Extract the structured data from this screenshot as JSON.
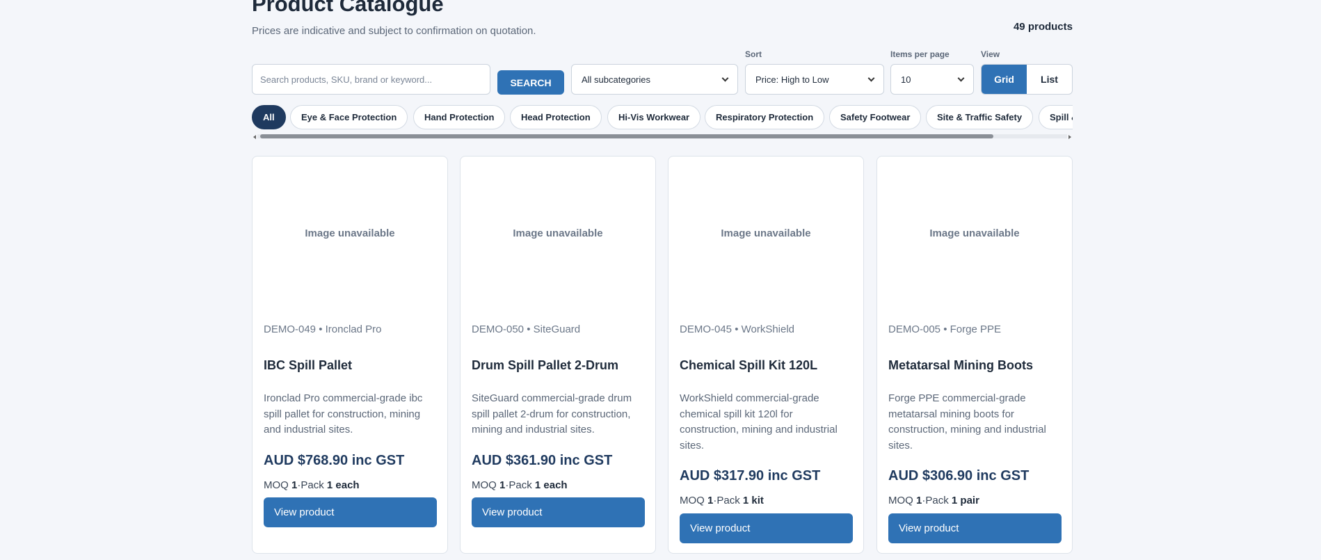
{
  "header": {
    "title": "Product Catalogue",
    "subtitle": "Prices are indicative and subject to confirmation on quotation.",
    "product_count": "49 products"
  },
  "filters": {
    "search_placeholder": "Search products, SKU, brand or keyword...",
    "search_button": "SEARCH",
    "subcategory": "All subcategories",
    "sort_label": "Sort",
    "sort_value": "Price: High to Low",
    "per_page_label": "Items per page",
    "per_page_value": "10",
    "view_label": "View",
    "view_grid": "Grid",
    "view_list": "List",
    "view_selected": "Grid"
  },
  "categories": [
    {
      "label": "All",
      "active": true
    },
    {
      "label": "Eye & Face Protection"
    },
    {
      "label": "Hand Protection"
    },
    {
      "label": "Head Protection"
    },
    {
      "label": "Hi-Vis Workwear"
    },
    {
      "label": "Respiratory Protection"
    },
    {
      "label": "Safety Footwear"
    },
    {
      "label": "Site & Traffic Safety"
    },
    {
      "label": "Spill &"
    }
  ],
  "products": [
    {
      "image_text": "Image unavailable",
      "meta": "DEMO-049 • Ironclad Pro",
      "name": "IBC Spill Pallet",
      "description": "Ironclad Pro commercial-grade ibc spill pallet for construction, mining and industrial sites.",
      "price": "AUD $768.90 inc GST",
      "moq_label": "MOQ",
      "moq": "1",
      "pack_label": "Pack",
      "pack": "1 each",
      "button": "View product"
    },
    {
      "image_text": "Image unavailable",
      "meta": "DEMO-050 • SiteGuard",
      "name": "Drum Spill Pallet 2-Drum",
      "description": "SiteGuard commercial-grade drum spill pallet 2-drum for construction, mining and industrial sites.",
      "price": "AUD $361.90 inc GST",
      "moq_label": "MOQ",
      "moq": "1",
      "pack_label": "Pack",
      "pack": "1 each",
      "button": "View product"
    },
    {
      "image_text": "Image unavailable",
      "meta": "DEMO-045 • WorkShield",
      "name": "Chemical Spill Kit 120L",
      "description": "WorkShield commercial-grade chemical spill kit 120l for construction, mining and industrial sites.",
      "price": "AUD $317.90 inc GST",
      "moq_label": "MOQ",
      "moq": "1",
      "pack_label": "Pack",
      "pack": "1 kit",
      "button": "View product"
    },
    {
      "image_text": "Image unavailable",
      "meta": "DEMO-005 • Forge PPE",
      "name": "Metatarsal Mining Boots",
      "description": "Forge PPE commercial-grade metatarsal mining boots for construction, mining and industrial sites.",
      "price": "AUD $306.90 inc GST",
      "moq_label": "MOQ",
      "moq": "1",
      "pack_label": "Pack",
      "pack": "1 pair",
      "button": "View product"
    }
  ],
  "colors": {
    "accent": "#2f72b5",
    "active_chip": "#1f3a5f",
    "background": "#f4f6fa"
  }
}
